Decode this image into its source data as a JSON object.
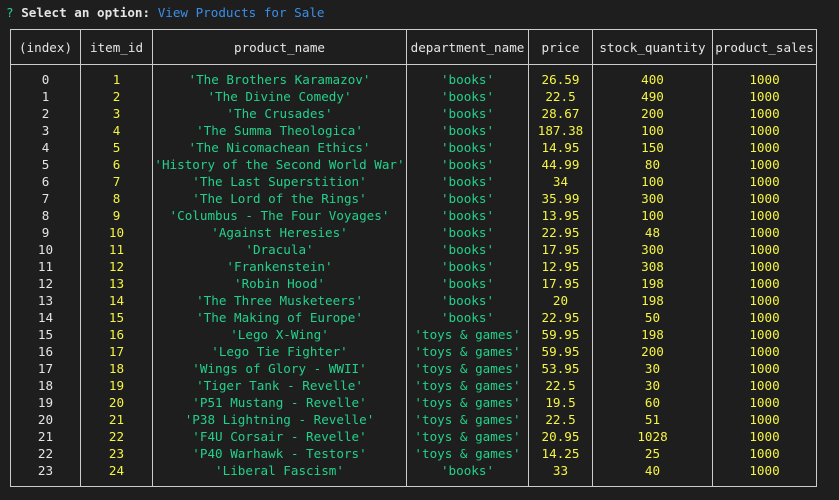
{
  "prompt": {
    "mark": "?",
    "question": "Select an option:",
    "selected": "View Products for Sale"
  },
  "table": {
    "headers": [
      "(index)",
      "item_id",
      "product_name",
      "department_name",
      "price",
      "stock_quantity",
      "product_sales"
    ],
    "rows": [
      [
        "0",
        "1",
        "'The Brothers Karamazov'",
        "'books'",
        "26.59",
        "400",
        "1000"
      ],
      [
        "1",
        "2",
        "'The Divine Comedy'",
        "'books'",
        "22.5",
        "490",
        "1000"
      ],
      [
        "2",
        "3",
        "'The Crusades'",
        "'books'",
        "28.67",
        "200",
        "1000"
      ],
      [
        "3",
        "4",
        "'The Summa Theologica'",
        "'books'",
        "187.38",
        "100",
        "1000"
      ],
      [
        "4",
        "5",
        "'The Nicomachean Ethics'",
        "'books'",
        "14.95",
        "150",
        "1000"
      ],
      [
        "5",
        "6",
        "'History of the Second World War'",
        "'books'",
        "44.99",
        "80",
        "1000"
      ],
      [
        "6",
        "7",
        "'The Last Superstition'",
        "'books'",
        "34",
        "100",
        "1000"
      ],
      [
        "7",
        "8",
        "'The Lord of the Rings'",
        "'books'",
        "35.99",
        "300",
        "1000"
      ],
      [
        "8",
        "9",
        "'Columbus - The Four Voyages'",
        "'books'",
        "13.95",
        "100",
        "1000"
      ],
      [
        "9",
        "10",
        "'Against Heresies'",
        "'books'",
        "22.95",
        "48",
        "1000"
      ],
      [
        "10",
        "11",
        "'Dracula'",
        "'books'",
        "17.95",
        "300",
        "1000"
      ],
      [
        "11",
        "12",
        "'Frankenstein'",
        "'books'",
        "12.95",
        "308",
        "1000"
      ],
      [
        "12",
        "13",
        "'Robin Hood'",
        "'books'",
        "17.95",
        "198",
        "1000"
      ],
      [
        "13",
        "14",
        "'The Three Musketeers'",
        "'books'",
        "20",
        "198",
        "1000"
      ],
      [
        "14",
        "15",
        "'The Making of Europe'",
        "'books'",
        "22.95",
        "50",
        "1000"
      ],
      [
        "15",
        "16",
        "'Lego X-Wing'",
        "'toys & games'",
        "59.95",
        "198",
        "1000"
      ],
      [
        "16",
        "17",
        "'Lego Tie Fighter'",
        "'toys & games'",
        "59.95",
        "200",
        "1000"
      ],
      [
        "17",
        "18",
        "'Wings of Glory - WWII'",
        "'toys & games'",
        "53.95",
        "30",
        "1000"
      ],
      [
        "18",
        "19",
        "'Tiger Tank - Revelle'",
        "'toys & games'",
        "22.5",
        "30",
        "1000"
      ],
      [
        "19",
        "20",
        "'P51 Mustang - Revelle'",
        "'toys & games'",
        "19.5",
        "60",
        "1000"
      ],
      [
        "20",
        "21",
        "'P38 Lightning - Revelle'",
        "'toys & games'",
        "22.5",
        "51",
        "1000"
      ],
      [
        "21",
        "22",
        "'F4U Corsair - Revelle'",
        "'toys & games'",
        "20.95",
        "1028",
        "1000"
      ],
      [
        "22",
        "23",
        "'P40 Warhawk - Testors'",
        "'toys & games'",
        "14.25",
        "25",
        "1000"
      ],
      [
        "23",
        "24",
        "'Liberal Fascism'",
        "'books'",
        "33",
        "40",
        "1000"
      ]
    ]
  }
}
